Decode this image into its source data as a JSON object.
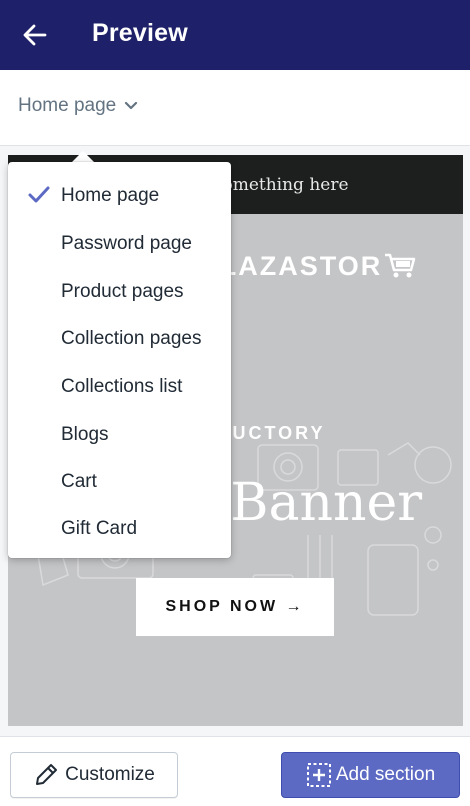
{
  "header": {
    "title": "Preview",
    "back_icon": "arrow-left-icon"
  },
  "page_selector": {
    "selected": "Home page",
    "chevron_icon": "chevron-down-icon"
  },
  "dropdown": {
    "items": [
      {
        "label": "Home page",
        "selected": true
      },
      {
        "label": "Password page",
        "selected": false
      },
      {
        "label": "Product pages",
        "selected": false
      },
      {
        "label": "Collection pages",
        "selected": false
      },
      {
        "label": "Collections list",
        "selected": false
      },
      {
        "label": "Blogs",
        "selected": false
      },
      {
        "label": "Cart",
        "selected": false
      },
      {
        "label": "Gift Card",
        "selected": false
      }
    ]
  },
  "preview": {
    "announcement": "Announce something here",
    "store_name": "PLAZASTOR",
    "banner_subtitle": "INTRODUCTORY",
    "banner_title": "Image Banner",
    "shop_button": "SHOP NOW →"
  },
  "bottom_bar": {
    "customize_label": "Customize",
    "add_section_label": "Add section"
  },
  "colors": {
    "header_bg": "#1e2169",
    "accent": "#5c6ac4",
    "check": "#5c6ac4"
  }
}
